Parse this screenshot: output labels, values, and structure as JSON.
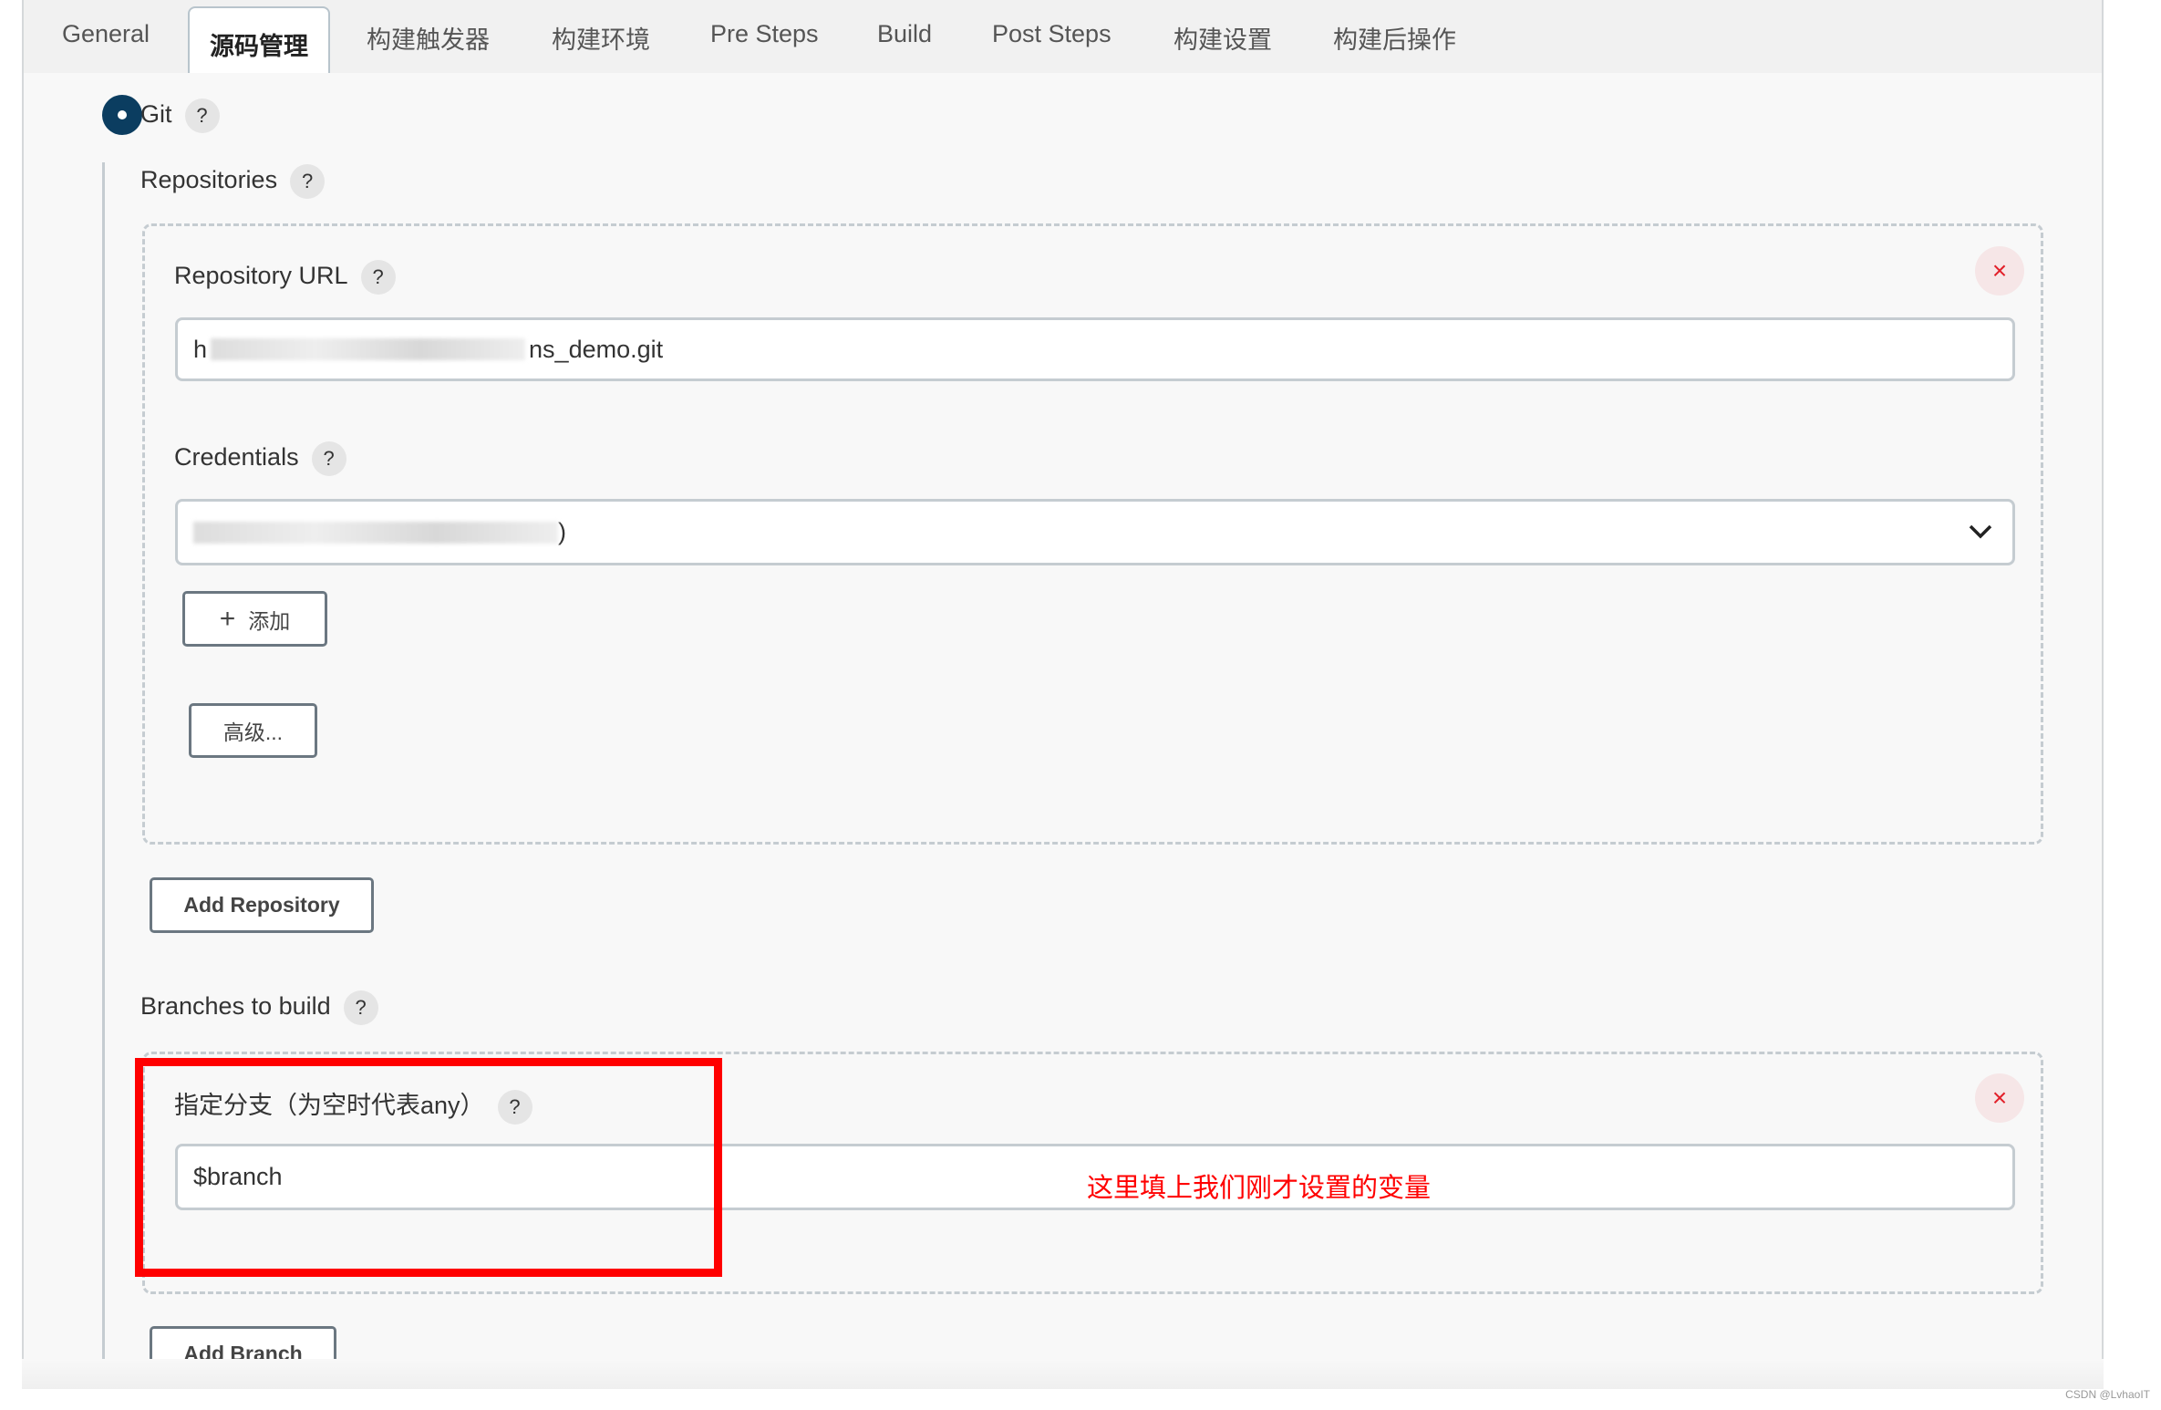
{
  "tabs": [
    "General",
    "源码管理",
    "构建触发器",
    "构建环境",
    "Pre Steps",
    "Build",
    "Post Steps",
    "构建设置",
    "构建后操作"
  ],
  "active_tab": "源码管理",
  "scm": {
    "label": "Git",
    "selected": true,
    "help": "?"
  },
  "repositories": {
    "label": "Repositories",
    "help": "?",
    "url_label": "Repository URL",
    "url_prefix": "h",
    "url_suffix": "ns_demo.git",
    "credentials_label": "Credentials",
    "credentials_suffix": ")",
    "add_label": "添加",
    "advanced_label": "高级...",
    "remove_icon": "×"
  },
  "add_repository": "Add Repository",
  "branches": {
    "label": "Branches to build",
    "help": "?",
    "spec_label": "指定分支（为空时代表any）",
    "spec_value": "$branch",
    "remove_icon": "×"
  },
  "add_branch": "Add Branch",
  "annotation": {
    "text": "这里填上我们刚才设置的变量",
    "color": "#ff0000"
  },
  "watermark": "CSDN @LvhaoIT",
  "colors": {
    "radio": "#0b3d60",
    "remove": "#e2202a"
  }
}
